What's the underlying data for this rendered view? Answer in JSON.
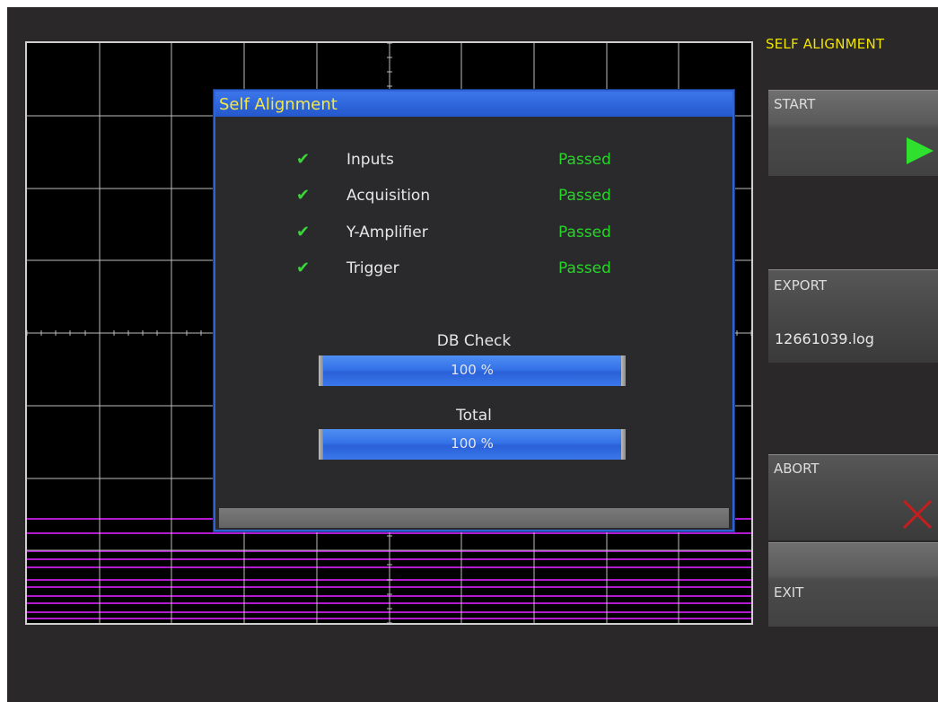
{
  "side_panel": {
    "title": "SELF ALIGNMENT",
    "start_label": "START",
    "export_label": "EXPORT",
    "export_file": "12661039.log",
    "abort_label": "ABORT",
    "exit_label": "EXIT"
  },
  "dialog": {
    "title": "Self Alignment",
    "checks": [
      {
        "name": "Inputs",
        "status": "Passed"
      },
      {
        "name": "Acquisition",
        "status": "Passed"
      },
      {
        "name": "Y-Amplifier",
        "status": "Passed"
      },
      {
        "name": "Trigger",
        "status": "Passed"
      }
    ],
    "db_check": {
      "label": "DB Check",
      "value_text": "100 %",
      "progress": 1.0
    },
    "total": {
      "label": "Total",
      "value_text": "100 %",
      "progress": 1.0
    }
  },
  "colors": {
    "accent_yellow": "#f0e400",
    "dialog_blue": "#2f62d4",
    "passed_green": "#27d627",
    "trace_magenta": "#b21ad0",
    "abort_red": "#c41e1e"
  },
  "icons": {
    "start": "play-icon",
    "abort": "close-icon",
    "check": "checkmark-icon"
  }
}
